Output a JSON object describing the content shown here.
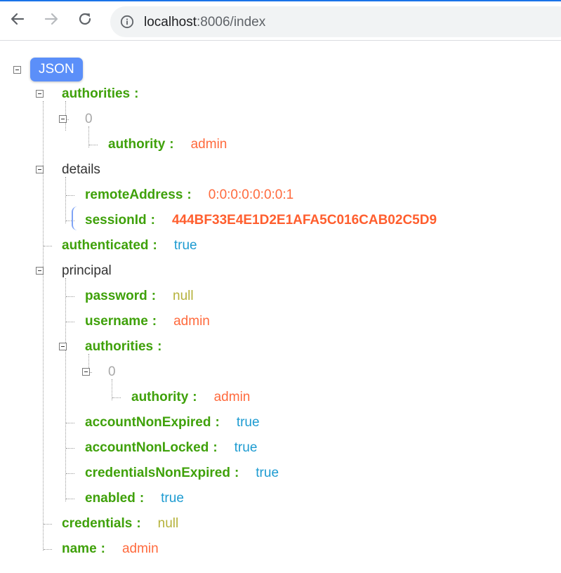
{
  "browser": {
    "url_host": "localhost",
    "url_rest": ":8006/index"
  },
  "tree": {
    "root_label": "JSON",
    "authorities_key": "authorities",
    "authorities_0_index": "0",
    "authorities_0_authority_key": "authority",
    "authorities_0_authority_value": "admin",
    "details_key": "details",
    "remoteAddress_key": "remoteAddress",
    "remoteAddress_value": "0:0:0:0:0:0:0:1",
    "sessionId_key": "sessionId",
    "sessionId_value": "444BF33E4E1D2E1AFA5C016CAB02C5D9",
    "authenticated_key": "authenticated",
    "authenticated_value": "true",
    "principal_key": "principal",
    "password_key": "password",
    "password_value": "null",
    "username_key": "username",
    "username_value": "admin",
    "p_authorities_key": "authorities",
    "p_authorities_0_index": "0",
    "p_authority_key": "authority",
    "p_authority_value": "admin",
    "accountNonExpired_key": "accountNonExpired",
    "accountNonExpired_value": "true",
    "accountNonLocked_key": "accountNonLocked",
    "accountNonLocked_value": "true",
    "credentialsNonExpired_key": "credentialsNonExpired",
    "credentialsNonExpired_value": "true",
    "enabled_key": "enabled",
    "enabled_value": "true",
    "credentials_key": "credentials",
    "credentials_value": "null",
    "name_key": "name",
    "name_value": "admin",
    "colon": ":"
  },
  "colors": {
    "key": "#3fa10a",
    "string": "#ff6a3d",
    "boolean": "#1d9bd1",
    "null": "#b5b23a",
    "root_badge": "#5b8ff9"
  },
  "icons": [
    "back-arrow-icon",
    "forward-arrow-icon",
    "reload-icon",
    "info-icon",
    "collapse-toggle-icon"
  ]
}
